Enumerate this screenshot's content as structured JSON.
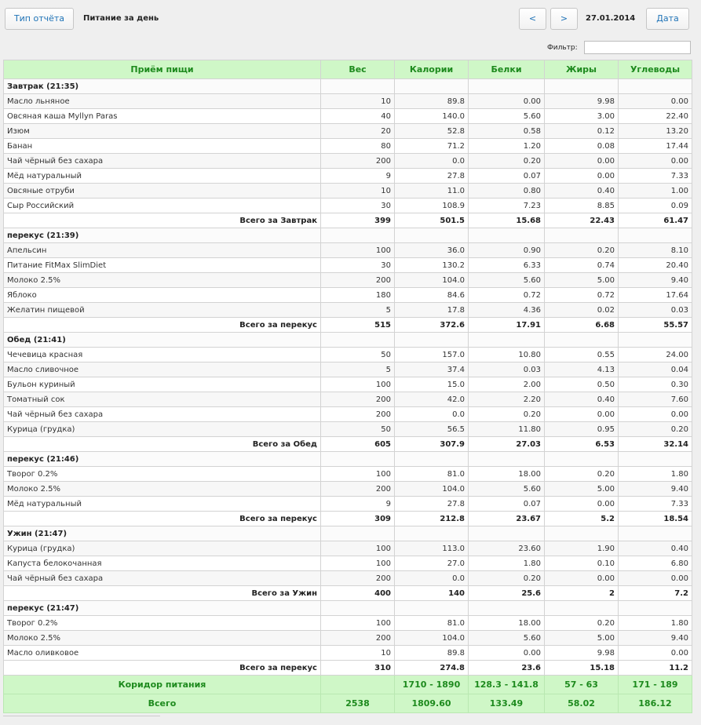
{
  "toolbar": {
    "report_type_label": "Тип отчёта",
    "title": "Питание за день",
    "prev_label": "<",
    "next_label": ">",
    "date": "27.01.2014",
    "date_button_label": "Дата"
  },
  "filter": {
    "label": "Фильтр:",
    "value": ""
  },
  "table": {
    "headers": [
      "Приём пищи",
      "Вес",
      "Калории",
      "Белки",
      "Жиры",
      "Углеводы"
    ],
    "meals": [
      {
        "name": "Завтрак (21:35)",
        "items": [
          [
            "Масло льняное",
            "10",
            "89.8",
            "0.00",
            "9.98",
            "0.00"
          ],
          [
            "Овсяная каша Myllyn Paras",
            "40",
            "140.0",
            "5.60",
            "3.00",
            "22.40"
          ],
          [
            "Изюм",
            "20",
            "52.8",
            "0.58",
            "0.12",
            "13.20"
          ],
          [
            "Банан",
            "80",
            "71.2",
            "1.20",
            "0.08",
            "17.44"
          ],
          [
            "Чай чёрный без сахара",
            "200",
            "0.0",
            "0.20",
            "0.00",
            "0.00"
          ],
          [
            "Мёд натуральный",
            "9",
            "27.8",
            "0.07",
            "0.00",
            "7.33"
          ],
          [
            "Овсяные отруби",
            "10",
            "11.0",
            "0.80",
            "0.40",
            "1.00"
          ],
          [
            "Сыр Российский",
            "30",
            "108.9",
            "7.23",
            "8.85",
            "0.09"
          ]
        ],
        "total": [
          "Всего за Завтрак",
          "399",
          "501.5",
          "15.68",
          "22.43",
          "61.47"
        ]
      },
      {
        "name": "перекус (21:39)",
        "items": [
          [
            "Апельсин",
            "100",
            "36.0",
            "0.90",
            "0.20",
            "8.10"
          ],
          [
            "Питание FitMax SlimDiet",
            "30",
            "130.2",
            "6.33",
            "0.74",
            "20.40"
          ],
          [
            "Молоко 2.5%",
            "200",
            "104.0",
            "5.60",
            "5.00",
            "9.40"
          ],
          [
            "Яблоко",
            "180",
            "84.6",
            "0.72",
            "0.72",
            "17.64"
          ],
          [
            "Желатин пищевой",
            "5",
            "17.8",
            "4.36",
            "0.02",
            "0.03"
          ]
        ],
        "total": [
          "Всего за перекус",
          "515",
          "372.6",
          "17.91",
          "6.68",
          "55.57"
        ]
      },
      {
        "name": "Обед (21:41)",
        "items": [
          [
            "Чечевица красная",
            "50",
            "157.0",
            "10.80",
            "0.55",
            "24.00"
          ],
          [
            "Масло сливочное",
            "5",
            "37.4",
            "0.03",
            "4.13",
            "0.04"
          ],
          [
            "Бульон куриный",
            "100",
            "15.0",
            "2.00",
            "0.50",
            "0.30"
          ],
          [
            "Томатный сок",
            "200",
            "42.0",
            "2.20",
            "0.40",
            "7.60"
          ],
          [
            "Чай чёрный без сахара",
            "200",
            "0.0",
            "0.20",
            "0.00",
            "0.00"
          ],
          [
            "Курица (грудка)",
            "50",
            "56.5",
            "11.80",
            "0.95",
            "0.20"
          ]
        ],
        "total": [
          "Всего за Обед",
          "605",
          "307.9",
          "27.03",
          "6.53",
          "32.14"
        ]
      },
      {
        "name": "перекус (21:46)",
        "items": [
          [
            "Творог 0.2%",
            "100",
            "81.0",
            "18.00",
            "0.20",
            "1.80"
          ],
          [
            "Молоко 2.5%",
            "200",
            "104.0",
            "5.60",
            "5.00",
            "9.40"
          ],
          [
            "Мёд натуральный",
            "9",
            "27.8",
            "0.07",
            "0.00",
            "7.33"
          ]
        ],
        "total": [
          "Всего за перекус",
          "309",
          "212.8",
          "23.67",
          "5.2",
          "18.54"
        ]
      },
      {
        "name": "Ужин (21:47)",
        "items": [
          [
            "Курица (грудка)",
            "100",
            "113.0",
            "23.60",
            "1.90",
            "0.40"
          ],
          [
            "Капуста белокочанная",
            "100",
            "27.0",
            "1.80",
            "0.10",
            "6.80"
          ],
          [
            "Чай чёрный без сахара",
            "200",
            "0.0",
            "0.20",
            "0.00",
            "0.00"
          ]
        ],
        "total": [
          "Всего за Ужин",
          "400",
          "140",
          "25.6",
          "2",
          "7.2"
        ]
      },
      {
        "name": "перекус (21:47)",
        "items": [
          [
            "Творог 0.2%",
            "100",
            "81.0",
            "18.00",
            "0.20",
            "1.80"
          ],
          [
            "Молоко 2.5%",
            "200",
            "104.0",
            "5.60",
            "5.00",
            "9.40"
          ],
          [
            "Масло оливковое",
            "10",
            "89.8",
            "0.00",
            "9.98",
            "0.00"
          ]
        ],
        "total": [
          "Всего за перекус",
          "310",
          "274.8",
          "23.6",
          "15.18",
          "11.2"
        ]
      }
    ],
    "corridor": [
      "Коридор питания",
      "",
      "1710 - 1890",
      "128.3 - 141.8",
      "57 - 63",
      "171 - 189"
    ],
    "grand_total": [
      "Всего",
      "2538",
      "1809.60",
      "133.49",
      "58.02",
      "186.12"
    ]
  },
  "colors": {
    "header_bg": "#cff7c7",
    "header_text": "#1d8a1d",
    "button_text": "#1f73b7"
  }
}
